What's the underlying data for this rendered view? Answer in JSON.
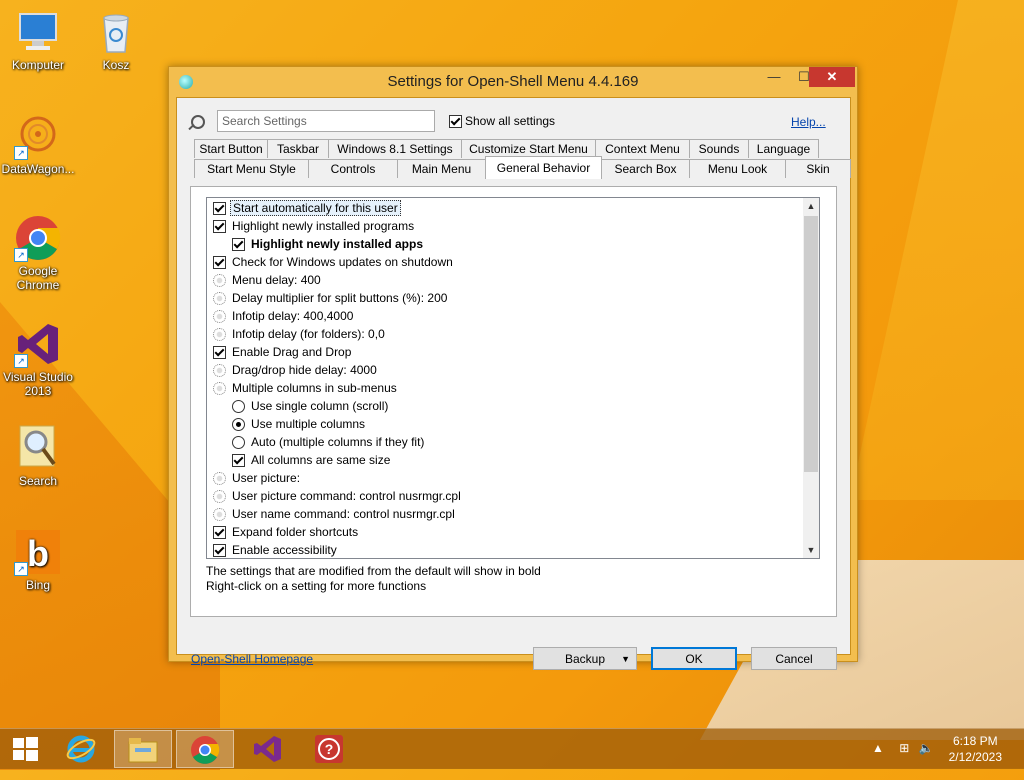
{
  "desktop": {
    "icons": [
      {
        "label": "Komputer"
      },
      {
        "label": "Kosz"
      },
      {
        "label": "DataWagon..."
      },
      {
        "label": "Google Chrome"
      },
      {
        "label": "Visual Studio 2013"
      },
      {
        "label": "Search"
      },
      {
        "label": "Bing"
      }
    ]
  },
  "window": {
    "title": "Settings for Open-Shell Menu 4.4.169",
    "search_placeholder": "Search Settings",
    "show_all_label": "Show all settings",
    "show_all_checked": true,
    "help_label": "Help...",
    "tabs_row1": [
      "Start Button",
      "Taskbar",
      "Windows 8.1 Settings",
      "Customize Start Menu",
      "Context Menu",
      "Sounds",
      "Language"
    ],
    "tabs_row2": [
      "Start Menu Style",
      "Controls",
      "Main Menu",
      "General Behavior",
      "Search Box",
      "Menu Look",
      "Skin"
    ],
    "active_tab": "General Behavior",
    "settings": [
      {
        "type": "check",
        "checked": true,
        "label": "Start automatically for this user",
        "indent": 0,
        "selected": true
      },
      {
        "type": "check",
        "checked": true,
        "label": "Highlight newly installed programs",
        "indent": 0
      },
      {
        "type": "check",
        "checked": true,
        "label": "Highlight newly installed apps",
        "indent": 1,
        "bold": true
      },
      {
        "type": "check",
        "checked": true,
        "label": "Check for Windows updates on shutdown",
        "indent": 0
      },
      {
        "type": "gear",
        "label": "Menu delay: 400",
        "indent": 0
      },
      {
        "type": "gear",
        "label": "Delay multiplier for split buttons (%): 200",
        "indent": 0
      },
      {
        "type": "gear",
        "label": "Infotip delay: 400,4000",
        "indent": 0
      },
      {
        "type": "gear",
        "label": "Infotip delay (for folders): 0,0",
        "indent": 0
      },
      {
        "type": "check",
        "checked": true,
        "label": "Enable Drag and Drop",
        "indent": 0
      },
      {
        "type": "gear",
        "label": "Drag/drop hide delay: 4000",
        "indent": 0
      },
      {
        "type": "gear",
        "label": "Multiple columns in sub-menus",
        "indent": 0
      },
      {
        "type": "radio",
        "checked": false,
        "label": "Use single column (scroll)",
        "indent": 1
      },
      {
        "type": "radio",
        "checked": true,
        "label": "Use multiple columns",
        "indent": 1
      },
      {
        "type": "radio",
        "checked": false,
        "label": "Auto (multiple columns if they fit)",
        "indent": 1
      },
      {
        "type": "check",
        "checked": true,
        "label": "All columns are same size",
        "indent": 1
      },
      {
        "type": "gear",
        "label": "User picture:",
        "indent": 0
      },
      {
        "type": "gear",
        "label": "User picture command: control nusrmgr.cpl",
        "indent": 0
      },
      {
        "type": "gear",
        "label": "User name command: control nusrmgr.cpl",
        "indent": 0
      },
      {
        "type": "check",
        "checked": true,
        "label": "Expand folder shortcuts",
        "indent": 0
      },
      {
        "type": "check",
        "checked": true,
        "label": "Enable accessibility",
        "indent": 0
      }
    ],
    "note_line1": "The settings that are modified from the default will show in bold",
    "note_line2": "Right-click on a setting for more functions",
    "homepage_label": "Open-Shell Homepage",
    "backup_label": "Backup",
    "ok_label": "OK",
    "cancel_label": "Cancel"
  },
  "taskbar": {
    "time": "6:18 PM",
    "date": "2/12/2023"
  },
  "colors": {
    "close_button": "#c7372f",
    "window_frame": "#f3be4e",
    "desktop": "#f5a50f"
  }
}
